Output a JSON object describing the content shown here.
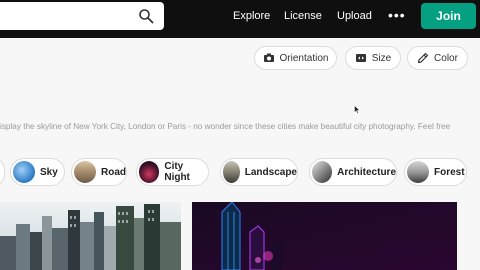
{
  "search": {
    "placeholder": ""
  },
  "nav": {
    "explore": "Explore",
    "license": "License",
    "upload": "Upload",
    "more": "•••",
    "join": "Join"
  },
  "filters": {
    "orientation": "Orientation",
    "size": "Size",
    "color": "Color"
  },
  "description": "isplay the skyline of New York City, London or Paris - no wonder since these cities make beautiful city photography. Feel free",
  "chips": [
    {
      "label": "Sky"
    },
    {
      "label": "Road"
    },
    {
      "label": "City Night"
    },
    {
      "label": "Landscape"
    },
    {
      "label": "Architecture"
    },
    {
      "label": "Forest"
    }
  ],
  "colors": {
    "join": "#05a081",
    "topbar": "#0f0f0f",
    "background": "#f7f7f7"
  },
  "icons": [
    "search-icon",
    "orientation-icon",
    "size-icon",
    "color-eyedropper-icon"
  ]
}
